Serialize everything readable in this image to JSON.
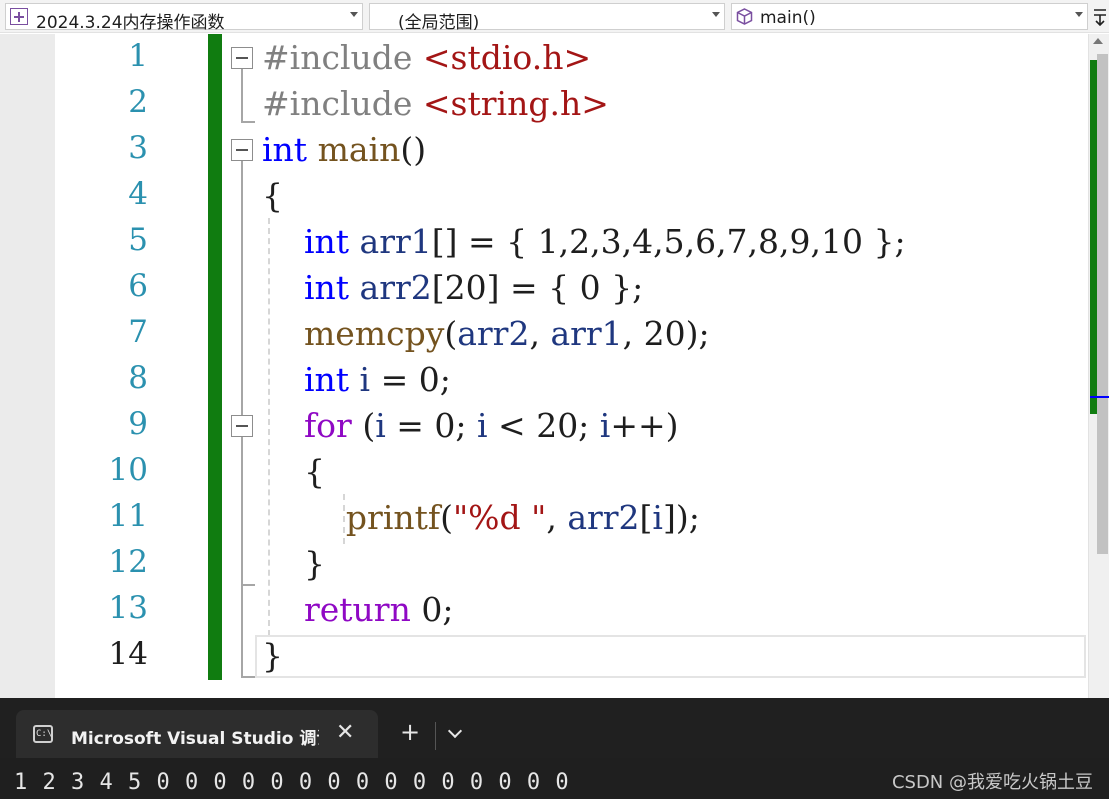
{
  "navbar": {
    "project": "2024.3.24内存操作函数",
    "scope": "(全局范围)",
    "member": "main()",
    "project_icon": "cpp-project-icon",
    "member_icon": "cube-icon",
    "split_icon": "split-editor-icon"
  },
  "editor": {
    "line_numbers": [
      "1",
      "2",
      "3",
      "4",
      "5",
      "6",
      "7",
      "8",
      "9",
      "10",
      "11",
      "12",
      "13",
      "14"
    ],
    "current_line": "14",
    "lines": [
      [
        {
          "t": "#include ",
          "c": "pp"
        },
        {
          "t": "<stdio.h>",
          "c": "str"
        }
      ],
      [
        {
          "t": "#include ",
          "c": "pp"
        },
        {
          "t": "<string.h>",
          "c": "str"
        }
      ],
      [
        {
          "t": "int",
          "c": "kw"
        },
        {
          "t": " ",
          "c": ""
        },
        {
          "t": "main",
          "c": "fn"
        },
        {
          "t": "()",
          "c": ""
        }
      ],
      [
        {
          "t": "{",
          "c": ""
        }
      ],
      [
        {
          "t": "    ",
          "c": ""
        },
        {
          "t": "int",
          "c": "kw"
        },
        {
          "t": " ",
          "c": ""
        },
        {
          "t": "arr1",
          "c": "var"
        },
        {
          "t": "[] = { 1,2,3,4,5,6,7,8,9,10 };",
          "c": ""
        }
      ],
      [
        {
          "t": "    ",
          "c": ""
        },
        {
          "t": "int",
          "c": "kw"
        },
        {
          "t": " ",
          "c": ""
        },
        {
          "t": "arr2",
          "c": "var"
        },
        {
          "t": "[20] = { 0 };",
          "c": ""
        }
      ],
      [
        {
          "t": "    ",
          "c": ""
        },
        {
          "t": "memcpy",
          "c": "fn"
        },
        {
          "t": "(",
          "c": ""
        },
        {
          "t": "arr2",
          "c": "var"
        },
        {
          "t": ", ",
          "c": ""
        },
        {
          "t": "arr1",
          "c": "var"
        },
        {
          "t": ", 20);",
          "c": ""
        }
      ],
      [
        {
          "t": "    ",
          "c": ""
        },
        {
          "t": "int",
          "c": "kw"
        },
        {
          "t": " ",
          "c": ""
        },
        {
          "t": "i",
          "c": "var"
        },
        {
          "t": " = 0;",
          "c": ""
        }
      ],
      [
        {
          "t": "    ",
          "c": ""
        },
        {
          "t": "for",
          "c": "ctl"
        },
        {
          "t": " (",
          "c": ""
        },
        {
          "t": "i",
          "c": "var"
        },
        {
          "t": " = 0; ",
          "c": ""
        },
        {
          "t": "i",
          "c": "var"
        },
        {
          "t": " < 20; ",
          "c": ""
        },
        {
          "t": "i",
          "c": "var"
        },
        {
          "t": "++)",
          "c": ""
        }
      ],
      [
        {
          "t": "    {",
          "c": ""
        }
      ],
      [
        {
          "t": "        ",
          "c": ""
        },
        {
          "t": "printf",
          "c": "fn"
        },
        {
          "t": "(",
          "c": ""
        },
        {
          "t": "\"",
          "c": "str"
        },
        {
          "t": "%d",
          "c": "fmt"
        },
        {
          "t": " \"",
          "c": "str"
        },
        {
          "t": ", ",
          "c": ""
        },
        {
          "t": "arr2",
          "c": "var"
        },
        {
          "t": "[",
          "c": ""
        },
        {
          "t": "i",
          "c": "var"
        },
        {
          "t": "]);",
          "c": ""
        }
      ],
      [
        {
          "t": "    }",
          "c": ""
        }
      ],
      [
        {
          "t": "    ",
          "c": ""
        },
        {
          "t": "return",
          "c": "ctl"
        },
        {
          "t": " 0;",
          "c": ""
        }
      ],
      [
        {
          "t": "}",
          "c": ""
        }
      ]
    ],
    "colors": {
      "keyword": "#0000ff",
      "control": "#8f08c4",
      "function": "#74531f",
      "variable": "#1f377f",
      "string": "#a31515",
      "preprocessor": "#808080",
      "line_number": "#2b91af",
      "change_bar": "#107c10"
    }
  },
  "console": {
    "tab_title": "Microsoft Visual Studio 调试控制台",
    "tab_icon": "terminal-icon",
    "icon_glyph": "C:\\",
    "close_glyph": "✕",
    "add_glyph": "+",
    "output": "1 2 3 4 5 0 0 0 0 0 0 0 0 0 0 0 0 0 0 0",
    "watermark": "CSDN @我爱吃火锅土豆"
  }
}
